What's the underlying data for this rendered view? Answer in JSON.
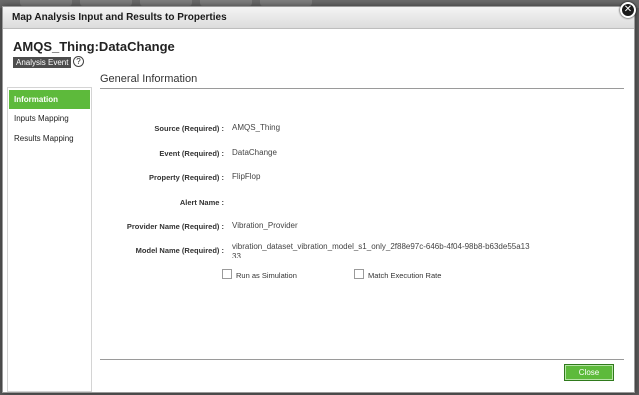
{
  "dialog": {
    "title": "Map Analysis Input and Results to Properties",
    "close_symbol": "✕"
  },
  "header": {
    "thing_title": "AMQS_Thing:DataChange",
    "badge": "Analysis Event",
    "help_symbol": "?"
  },
  "sidebar": {
    "items": [
      {
        "label": "Information",
        "active": true
      },
      {
        "label": "Inputs Mapping",
        "active": false
      },
      {
        "label": "Results Mapping",
        "active": false
      }
    ]
  },
  "section": {
    "title": "General Information"
  },
  "form": {
    "source_label": "Source (Required) :",
    "source_value": "AMQS_Thing",
    "event_label": "Event (Required) :",
    "event_value": "DataChange",
    "property_label": "Property (Required) :",
    "property_value": "FlipFlop",
    "alert_label": "Alert Name :",
    "alert_value": "",
    "provider_label": "Provider Name (Required) :",
    "provider_value": "Vibration_Provider",
    "model_label": "Model Name (Required) :",
    "model_value": "vibration_dataset_vibration_model_s1_only_2f88e97c-646b-4f04-98b8-b63de55a1333",
    "run_simulation_label": "Run as Simulation",
    "match_rate_label": "Match Execution Rate"
  },
  "footer": {
    "close_label": "Close"
  },
  "colors": {
    "accent_green": "#5dba3b",
    "badge_gray": "#4d4d4d",
    "overlay": "#5c5c5c"
  }
}
